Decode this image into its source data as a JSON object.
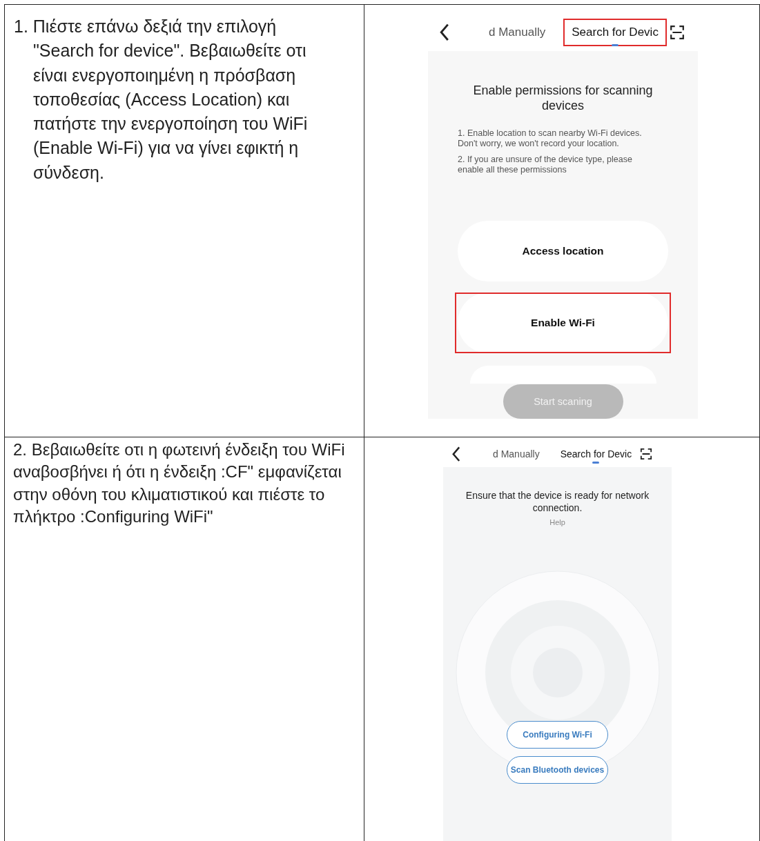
{
  "steps": [
    {
      "instruction": "1. Πιέστε επάνω δεξιά την επιλογή \"Search for device\". Βεβαιωθείτε οτι είναι ενεργοποιημένη η πρόσβαση τοποθεσίας (Access Location) και πατήστε την ενεργοποίηση του WiFi (Enable Wi-Fi) για να γίνει εφικτή η σύνδεση.",
      "screen": {
        "kind": "permissions",
        "tabs": [
          {
            "label": "d Manually",
            "selected": false,
            "highlighted": false
          },
          {
            "label": "Search for Devic",
            "selected": true,
            "highlighted": true
          }
        ],
        "title": "Enable permissions for scanning devices",
        "notes": [
          "1. Enable location to scan nearby Wi-Fi devices. Don't worry, we won't record your location.",
          "2. If you are unsure of the device type, please enable all these permissions"
        ],
        "buttons": [
          {
            "label": "Access location",
            "highlighted": false
          },
          {
            "label": "Enable Wi-Fi",
            "highlighted": true
          }
        ],
        "primary": {
          "label": "Start scaning",
          "disabled": true
        }
      }
    },
    {
      "instruction": "2. Βεβαιωθείτε οτι η φωτεινή ένδειξη του WiFi αναβοσβήνει ή ότι η ένδειξη :CF\" εμφανίζεται στην οθόνη του κλιματιστικού και πιέστε το πλήκτρο :Configuring WiFi\"",
      "screen": {
        "kind": "ready",
        "tabs": [
          {
            "label": "d Manually",
            "selected": false,
            "highlighted": false
          },
          {
            "label": "Search for Devic",
            "selected": true,
            "highlighted": false
          }
        ],
        "title": "Ensure that the device is ready for network connection.",
        "help": "Help",
        "buttons": [
          {
            "label": "Configuring Wi-Fi",
            "highlighted": false
          },
          {
            "label": "Scan Bluetooth devices",
            "highlighted": false
          }
        ]
      }
    }
  ]
}
